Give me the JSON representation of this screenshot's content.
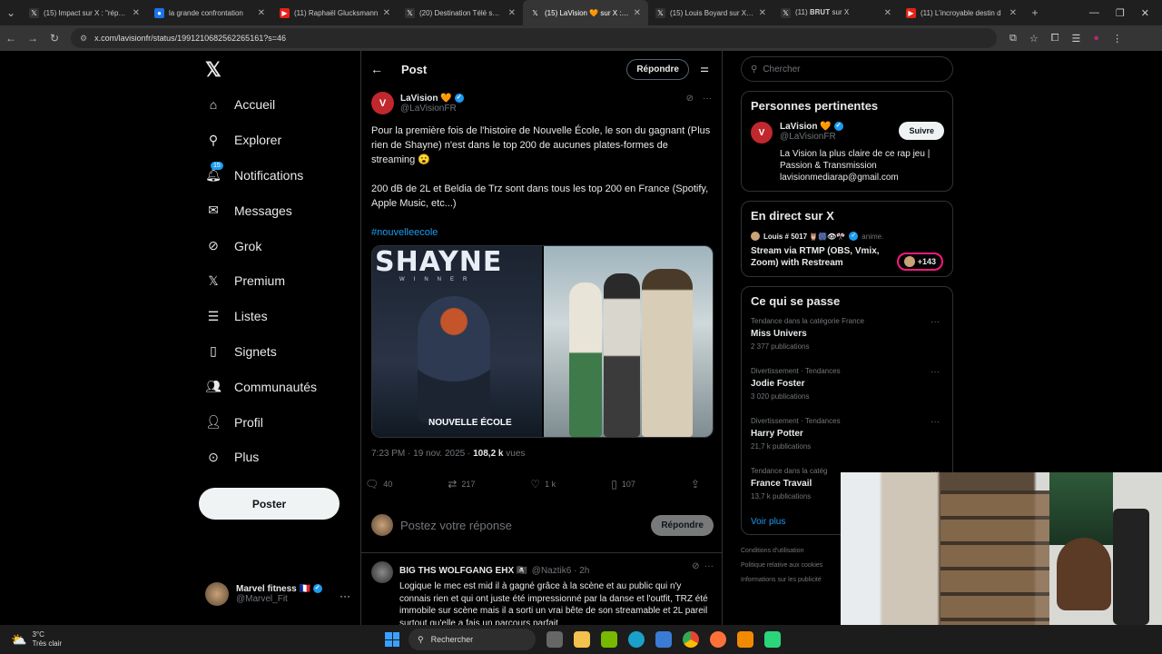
{
  "browser": {
    "tabs": [
      {
        "label": "(15) Impact sur X : \"réps F",
        "active": false
      },
      {
        "label": "la grande confrontation",
        "active": false
      },
      {
        "label": "(11) Raphaël Glucksmann",
        "active": false
      },
      {
        "label": "(20) Destination Télé sur X",
        "active": false
      },
      {
        "label": "(15) LaVision 🧡 sur X : \"P",
        "active": true
      },
      {
        "label": "(15) Louis Boyard sur X : \"",
        "active": false
      },
      {
        "label": "(11) 𝐁𝐑𝐔𝐓 sur X",
        "active": false
      },
      {
        "label": "(11) L'incroyable destin d",
        "active": false
      }
    ],
    "url": "x.com/lavisionfr/status/1991210682562265161?s=46"
  },
  "sidebar": {
    "items": [
      {
        "label": "Accueil",
        "icon": "home-icon"
      },
      {
        "label": "Explorer",
        "icon": "search-icon"
      },
      {
        "label": "Notifications",
        "icon": "bell-icon",
        "badge": "15"
      },
      {
        "label": "Messages",
        "icon": "envelope-icon"
      },
      {
        "label": "Grok",
        "icon": "grok-icon"
      },
      {
        "label": "Premium",
        "icon": "x-icon"
      },
      {
        "label": "Listes",
        "icon": "list-icon"
      },
      {
        "label": "Signets",
        "icon": "bookmark-icon"
      },
      {
        "label": "Communautés",
        "icon": "people-icon"
      },
      {
        "label": "Profil",
        "icon": "person-icon"
      },
      {
        "label": "Plus",
        "icon": "more-circle-icon"
      }
    ],
    "post_label": "Poster",
    "account": {
      "name": "Marvel fitness 🇫🇷",
      "handle": "@Marvel_Fit"
    }
  },
  "main": {
    "title": "Post",
    "reply_top": "Répondre",
    "tweet": {
      "name": "LaVision 🧡",
      "handle": "@LaVisionFR",
      "text1": "Pour la première fois de l'histoire de Nouvelle École, le son du gagnant (Plus rien de Shayne) n'est dans le top 200 de aucunes plates-formes de streaming 😮",
      "text2": "200 dB de 2L et Beldia de Trz sont dans tous les top 200 en France (Spotify, Apple Music, etc...)",
      "hashtag": "#nouvelleecole",
      "image1_text": "SHAYNE",
      "image1_sub": "WINNER",
      "image1_logo": "NOUVELLE ÉCOLE",
      "time": "7:23 PM · 19 nov. 2025 · ",
      "views_count": "108,2 k",
      "views_label": " vues",
      "stats": {
        "replies": "40",
        "retweets": "217",
        "likes": "1 k",
        "bookmarks": "107"
      }
    },
    "reply_placeholder": "Postez votre réponse",
    "reply_button": "Répondre",
    "reply": {
      "name": "BIG THS WOLFGANG EHX 🏴‍☠️",
      "handle": "@Naztik6 · 2h",
      "text": "Logique le mec est mid il à gagné grâce à la scène et au public qui n'y connais rien et qui ont juste été impressionné par la danse et l'outfit, TRZ été immobile sur scène mais il a sorti un vrai bête de son streamable et 2L pareil surtout qu'elle a fais un parcours parfait"
    }
  },
  "right": {
    "search_placeholder": "Chercher",
    "relevant": {
      "title": "Personnes pertinentes",
      "name": "LaVision 🧡",
      "handle": "@LaVisionFR",
      "follow": "Suivre",
      "bio": "La Vision la plus claire de ce rap jeu | Passion & Transmission lavisionmediarap@gmail.com"
    },
    "live": {
      "title": "En direct sur X",
      "host": "Louis # 5017 🦉🎆👁🎌",
      "host_tag": "anime.",
      "stream_title": "Stream via RTMP (OBS, Vmix, Zoom) with Restream",
      "count": "+143"
    },
    "trends": {
      "title": "Ce qui se passe",
      "items": [
        {
          "category": "Tendance dans la catégorie France",
          "name": "Miss Univers",
          "count": "2 377 publications"
        },
        {
          "category": "Divertissement · Tendances",
          "name": "Jodie Foster",
          "count": "3 020 publications"
        },
        {
          "category": "Divertissement · Tendances",
          "name": "Harry Potter",
          "count": "21,7 k publications"
        },
        {
          "category": "Tendance dans la catég",
          "name": "France Travail",
          "count": "13,7 k publications"
        }
      ],
      "more": "Voir plus"
    },
    "footer": [
      "Conditions d'utilisation",
      "Politique relative aux cookies",
      "Informations sur les publicité"
    ]
  },
  "taskbar": {
    "temp": "3°C",
    "weather": "Très clair",
    "search": "Rechercher"
  }
}
